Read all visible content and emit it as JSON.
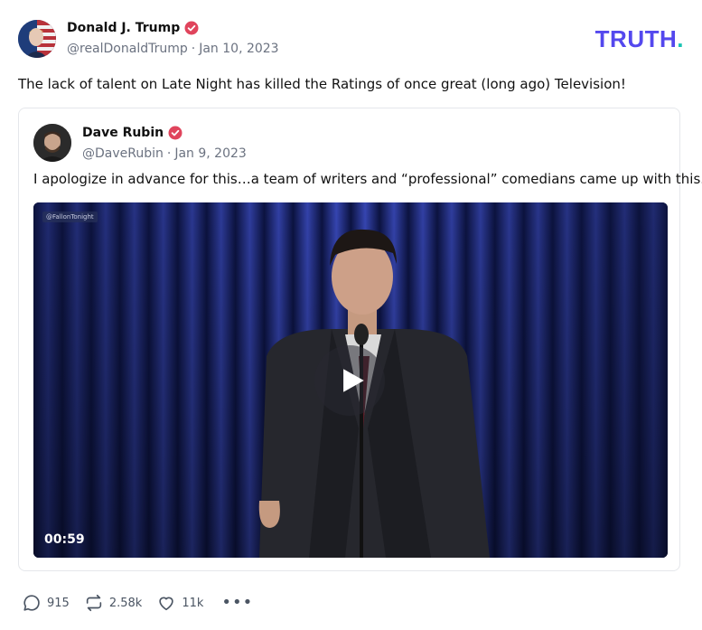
{
  "brand": {
    "name": "TRUTH",
    "dot": "."
  },
  "post": {
    "author": {
      "name": "Donald J. Trump",
      "handle": "@realDonaldTrump",
      "date": "Jan 10, 2023"
    },
    "separator": "·",
    "text": "The lack of talent on Late Night has killed the Ratings of once great (long ago) Television!",
    "actions": {
      "replies": "915",
      "retruths": "2.58k",
      "likes": "11k",
      "more": "•••"
    }
  },
  "quoted": {
    "author": {
      "name": "Dave Rubin",
      "handle": "@DaveRubin",
      "date": "Jan 9, 2023"
    },
    "separator": "·",
    "text": "I apologize in advance for this…a team of writers and “professional” comedians came up with this.",
    "video": {
      "watermark": "@FallonTonight",
      "duration": "00:59"
    }
  },
  "colors": {
    "brand": "#5448ee",
    "brand_dot": "#17c3b2",
    "verified": "#e0445c",
    "muted": "#6b7280"
  },
  "icons": [
    "verified-badge-icon",
    "reply-icon",
    "retruth-icon",
    "like-icon",
    "more-icon",
    "play-icon"
  ]
}
